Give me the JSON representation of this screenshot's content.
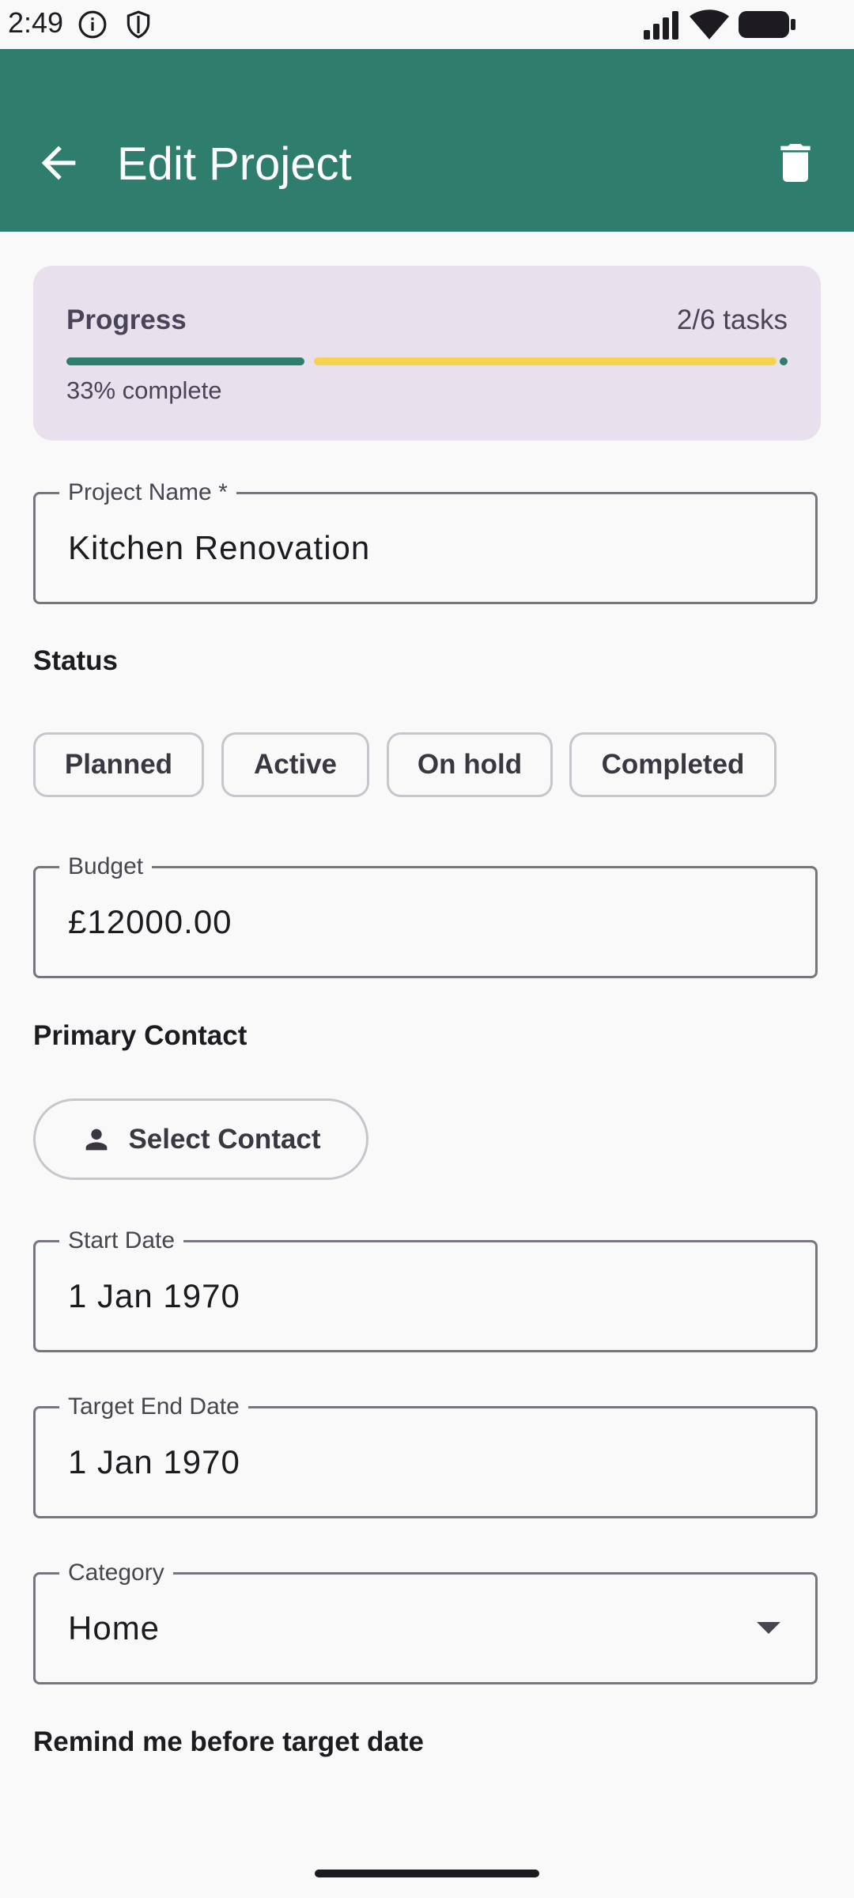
{
  "status_bar": {
    "time": "2:49"
  },
  "app_bar": {
    "title": "Edit Project"
  },
  "progress": {
    "label": "Progress",
    "count": "2/6 tasks",
    "percent_text": "33% complete",
    "fraction": 0.33,
    "colors": {
      "fill": "#2F7D6D",
      "rest": "#F7D24F",
      "card": "#E8E0EC"
    }
  },
  "fields": {
    "project_name": {
      "label": "Project Name *",
      "value": "Kitchen Renovation"
    },
    "budget": {
      "label": "Budget",
      "value": "£12000.00"
    },
    "start_date": {
      "label": "Start Date",
      "value": "1 Jan 1970"
    },
    "target_end_date": {
      "label": "Target End Date",
      "value": "1 Jan 1970"
    },
    "category": {
      "label": "Category",
      "value": "Home"
    }
  },
  "status_section": {
    "heading": "Status",
    "chips": [
      "Planned",
      "Active",
      "On hold",
      "Completed"
    ]
  },
  "contact_section": {
    "heading": "Primary Contact",
    "button_label": "Select Contact"
  },
  "reminder_section": {
    "heading": "Remind me before target date"
  },
  "theme": {
    "primary": "#2F7D6D",
    "background": "#F9F9FA"
  }
}
